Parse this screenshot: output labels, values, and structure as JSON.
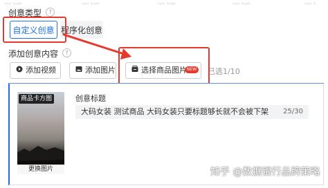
{
  "creative_type": {
    "label": "创意类型",
    "options": [
      {
        "label": "自定义创意",
        "selected": true
      },
      {
        "label": "程序化创意",
        "selected": false
      }
    ]
  },
  "add_content": {
    "label": "添加创意内容",
    "buttons": {
      "add_video": "添加视频",
      "add_image": "添加图片",
      "select_product_image": "选择商品图片"
    },
    "new_badge": "NEW",
    "selected_count": "已选1/10"
  },
  "creative_card": {
    "image_badge": "商品卡方图",
    "change_image": "更换图片",
    "title_label": "创意标题",
    "title_value": "大码女装 测试商品 大码女装只要标题够长就不会被下架",
    "title_count": "25/30"
  },
  "watermark": "知乎 @数据银行品牌策略",
  "colors": {
    "accent": "#1f6fe0",
    "annotation_red": "#e5392f"
  }
}
